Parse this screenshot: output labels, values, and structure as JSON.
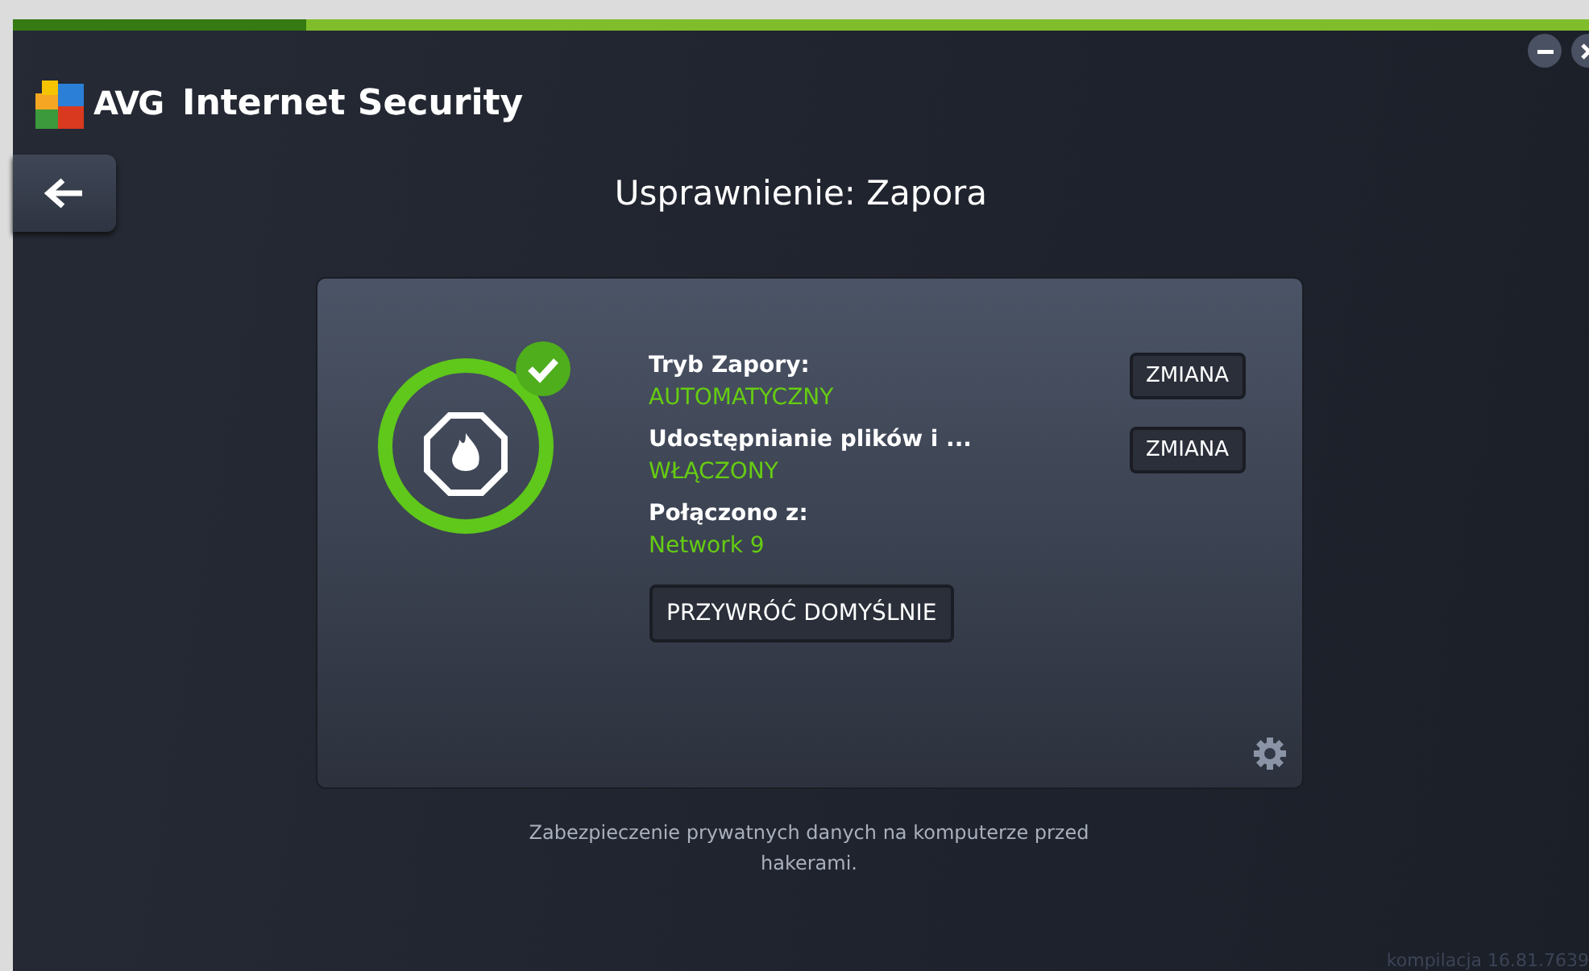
{
  "window": {
    "title_brand": "AVG",
    "title": "Internet Security",
    "build": "kompilacja 16.81.7639"
  },
  "heading": "Usprawnienie: Zapora",
  "status": {
    "ok": true
  },
  "settings": [
    {
      "label": "Tryb Zapory:",
      "value": "AUTOMATYCZNY",
      "action": "ZMIANA"
    },
    {
      "label": "Udostępnianie plików i ...",
      "value": "WŁĄCZONY",
      "action": "ZMIANA"
    },
    {
      "label": "Połączono z:",
      "value": "Network  9"
    }
  ],
  "restore_button": "PRZYWRÓĆ DOMYŚLNIE",
  "description": "Zabezpieczenie prywatnych danych na komputerze przed hakerami."
}
